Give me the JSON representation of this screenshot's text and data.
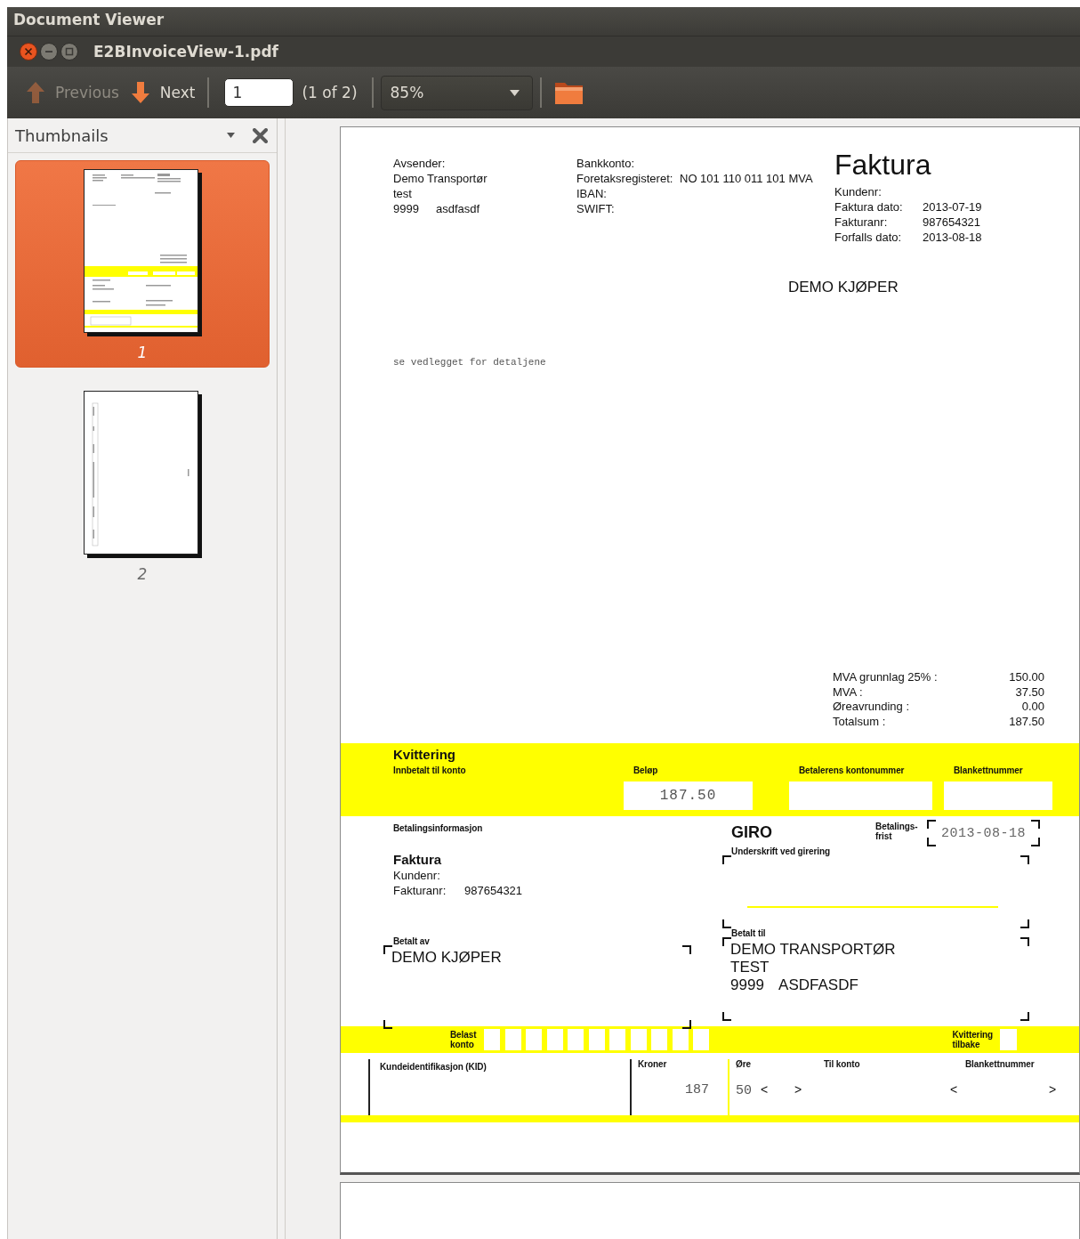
{
  "window": {
    "app_title": "Document Viewer",
    "title": "E2BInvoiceView-1.pdf"
  },
  "toolbar": {
    "previous": {
      "label": "Previous",
      "disabled": true
    },
    "next": {
      "label": "Next",
      "disabled": false
    },
    "page_field": "1",
    "page_count": "(1 of 2)",
    "zoom": "85%"
  },
  "sidebar": {
    "title": "Thumbnails",
    "pages": [
      {
        "label": "1",
        "kind": "invoice",
        "selected": true
      },
      {
        "label": "2",
        "kind": "table",
        "selected": false
      }
    ]
  },
  "document": {
    "sender": {
      "heading": "Avsender:",
      "lines": [
        "Demo Transportør",
        "test"
      ],
      "postcode": "9999",
      "city": "asdfasdf"
    },
    "bank": {
      "heading": "Bankkonto:",
      "rows": [
        {
          "label": "Foretaksregisteret:",
          "value": "NO 101 110 011 101 MVA"
        },
        {
          "label": "IBAN:"
        },
        {
          "label": "SWIFT:"
        }
      ]
    },
    "title": "Faktura",
    "meta": [
      {
        "label": "Kundenr:"
      },
      {
        "label": "Faktura dato:",
        "value": "2013-07-19"
      },
      {
        "label": "Fakturanr:",
        "value": "987654321"
      },
      {
        "label": "Forfalls dato:",
        "value": "2013-08-18"
      }
    ],
    "buyer": "DEMO KJØPER",
    "note": "se vedlegget for detaljene",
    "totals": [
      {
        "label": "MVA grunnlag 25% :",
        "value": "150.00"
      },
      {
        "label": "MVA :",
        "value": "37.50"
      },
      {
        "label": "Øreavrunding :",
        "value": "0.00"
      },
      {
        "label": "Totalsum :",
        "value": "187.50"
      }
    ],
    "receipt": {
      "title": "Kvittering",
      "paid_to_label": "Innbetalt til konto",
      "amount_label": "Beløp",
      "amount": "187.50",
      "payer_account_label": "Betalerens kontonummer",
      "form_number_label": "Blankettnummer"
    },
    "giro": {
      "info_heading": "Betalingsinformasjon",
      "info_title": "Faktura",
      "info_rows": [
        {
          "label": "Kundenr:"
        },
        {
          "label": "Fakturanr:",
          "value": "987654321"
        }
      ],
      "title": "GIRO",
      "due_label": [
        "Betalings-",
        "frist"
      ],
      "due_date": "2013-08-18",
      "signature_label": "Underskrift ved girering",
      "paid_by_label": "Betalt av",
      "paid_by": [
        "DEMO KJØPER"
      ],
      "paid_to_label": "Betalt til",
      "paid_to": [
        "DEMO TRANSPORTØR",
        "TEST"
      ],
      "paid_to_postcode": "9999",
      "paid_to_city": "ASDFASDF"
    },
    "strip": {
      "debit_label": [
        "Belast",
        "konto"
      ],
      "receipt_return_label": [
        "Kvittering",
        "tilbake"
      ]
    },
    "slip": {
      "kid_label": "Kundeidentifikasjon (KID)",
      "kroner_label": "Kroner",
      "ore_label": "Øre",
      "to_account_label": "Til konto",
      "form_number_label": "Blankettnummer",
      "kroner": "187",
      "ore": "50",
      "to_account_open": "<",
      "to_account_close": ">",
      "form_number_open": "<",
      "form_number_close": ">"
    }
  }
}
